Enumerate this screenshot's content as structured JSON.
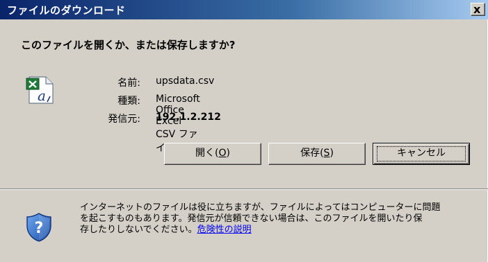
{
  "window": {
    "title": "ファイルのダウンロード",
    "close_label": "x"
  },
  "question": "このファイルを開くか、または保存しますか?",
  "file": {
    "icon": "excel-csv-file-icon",
    "name_label": "名前:",
    "name_value": "upsdata.csv",
    "type_label": "種類:",
    "type_value": "Microsoft Office Excel CSV ファイル",
    "source_label": "発信元:",
    "source_value": "192.1.2.212"
  },
  "buttons": {
    "open": {
      "text": "開く(",
      "key": "O",
      "suffix": ")"
    },
    "save": {
      "text": "保存(",
      "key": "S",
      "suffix": ")"
    },
    "cancel": "キャンセル"
  },
  "info": {
    "icon": "security-shield-question-icon",
    "line1": "インターネットのファイルは役に立ちますが、ファイルによってはコンピューターに問題",
    "line2": "を起こすものもあります。発信元が信頼できない場合は、このファイルを開いたり保",
    "line3": "存したりしないでください。",
    "link": "危険性の説明"
  },
  "colors": {
    "titlebar_start": "#0a246a",
    "titlebar_end": "#a6caf0",
    "face": "#d4d0c8",
    "link": "#0000ee"
  }
}
